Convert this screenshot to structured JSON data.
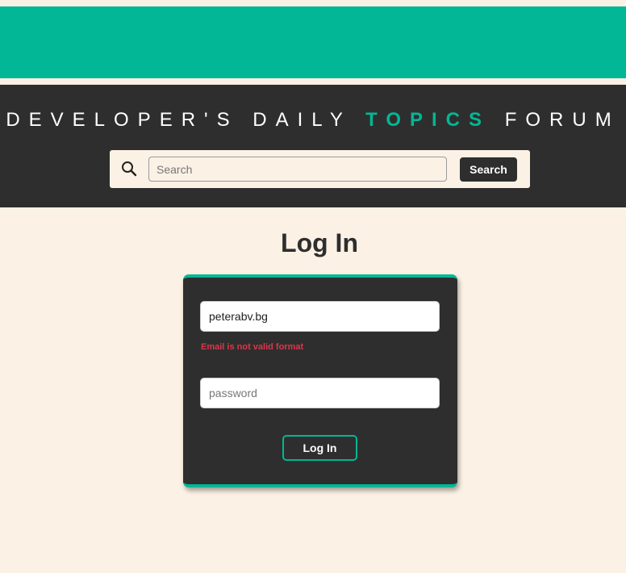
{
  "header": {
    "title_part1": "DEVELOPER'S DAILY ",
    "title_accent": "TOPICS",
    "title_part2": " FORUM",
    "search": {
      "placeholder": "Search",
      "value": "",
      "button_label": "Search",
      "icon": "search-icon"
    }
  },
  "main": {
    "page_title": "Log In",
    "form": {
      "email_value": "peterabv.bg",
      "email_error": "Email is not valid format",
      "password_placeholder": "password",
      "password_value": "",
      "submit_label": "Log In"
    }
  },
  "colors": {
    "accent": "#02b795",
    "dark": "#2e2e2e",
    "background": "#fbf1e5",
    "error": "#e0334a"
  }
}
